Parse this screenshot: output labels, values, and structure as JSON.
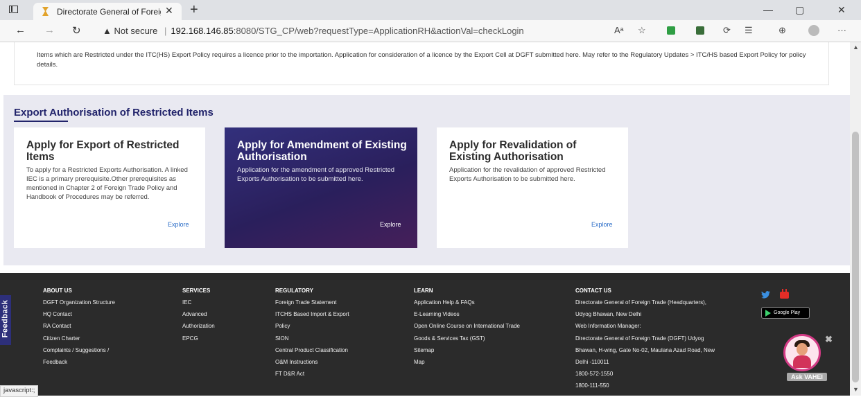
{
  "browser": {
    "tab_title": "Directorate General of Foreign Trade",
    "tab_close": "✕",
    "new_tab": "+",
    "address": {
      "warning": "▲",
      "not_secure": "Not secure",
      "separator": "|",
      "host": "192.168.146.85",
      "path": ":8080/STG_CP/web?requestType=ApplicationRH&actionVal=checkLogin"
    },
    "toolbar_icons": {
      "read_aloud": "Aᵃ",
      "favorite": "☆",
      "collections": "⊕",
      "more": "···"
    },
    "window": {
      "minimize": "—",
      "restore": "▢",
      "close": "✕"
    }
  },
  "info_card": {
    "text": "Items which are Restricted under the ITC(HS) Export Policy requires a licence prior to the importation. Application for consideration of a licence by the Export Cell at DGFT submitted here. May refer to the Regulatory Updates > ITC/HS based Export Policy for policy details."
  },
  "section": {
    "title": "Export Authorisation of Restricted Items",
    "cards": [
      {
        "title": "Apply for Export of Restricted Items",
        "description": "To apply for a Restricted Exports Authorisation. A linked IEC is a primary prerequisite.Other prerequisites as mentioned in Chapter 2 of Foreign Trade Policy and Handbook of Procedures may be referred.",
        "link": "Explore"
      },
      {
        "title": "Apply for Amendment of Existing Authorisation",
        "description": "Application for the amendment of approved Restricted Exports Authorisation to be submitted here.",
        "link": "Explore"
      },
      {
        "title": "Apply for Revalidation of Existing Authorisation",
        "description": "Application for the revalidation of approved Restricted Exports Authorisation to be submitted here.",
        "link": "Explore"
      }
    ]
  },
  "footer": {
    "feedback": "Feedback",
    "about": {
      "heading": "ABOUT US",
      "items": [
        "DGFT Organization Structure",
        "HQ Contact",
        "RA Contact",
        "Citizen Charter",
        "Complaints / Suggestions /",
        "Feedback"
      ]
    },
    "services": {
      "heading": "SERVICES",
      "items": [
        "IEC",
        "Advanced",
        "Authorization",
        "EPCG"
      ]
    },
    "regulatory": {
      "heading": "REGULATORY",
      "items": [
        "Foreign Trade Statement",
        "ITCHS Based Import & Export",
        "Policy",
        "SION",
        "Central Product Classification",
        "O&M Instructions",
        "FT D&R Act"
      ]
    },
    "learn": {
      "heading": "LEARN",
      "items": [
        "Application Help & FAQs",
        "E-Learning Videos",
        "Open Online Course on International Trade",
        "Goods & Services Tax (GST)",
        "Sitemap",
        "Map"
      ]
    },
    "contact": {
      "heading": "CONTACT US",
      "items": [
        "Directorate General of Foreign Trade (Headquarters),",
        "Udyog Bhawan, New Delhi",
        "Web Information Manager:",
        "Directorate General of Foreign Trade (DGFT) Udyog",
        "Bhawan, H-wing, Gate No-02, Maulana Azad Road, New",
        "Delhi -110011",
        "1800-572-1550",
        "1800-111-550"
      ]
    },
    "google_play": "Google Play",
    "ask_vahei": "Ask VAHEI",
    "vahei_close": "✖"
  },
  "status_bar": "javascript:;",
  "colors": {
    "accent": "#22246b",
    "band": "#e9e9f1",
    "footer": "#2b2b2b",
    "link": "#2a6cc7",
    "feedback": "#2d2f7a"
  }
}
